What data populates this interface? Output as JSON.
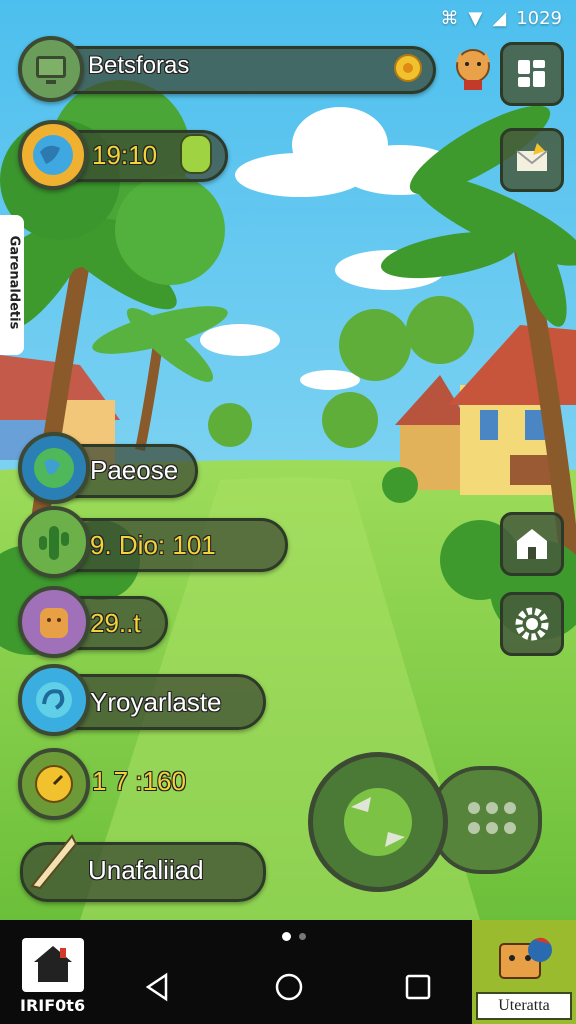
{
  "status_bar": {
    "time": "1029"
  },
  "top_bar": {
    "title": "Betsforas"
  },
  "timer": {
    "value": "19:10"
  },
  "side_text": "Garenaldetis",
  "menu": [
    {
      "label": "Paeose"
    },
    {
      "label": "9. Dio: 101"
    },
    {
      "label": "29..t"
    },
    {
      "label": "Yroyarlaste"
    },
    {
      "label": "1 7 :160"
    },
    {
      "label": "Unafaliiad"
    }
  ],
  "nav": {
    "left_label": "IRIF0t6",
    "right_label": "Uteratta"
  },
  "colors": {
    "sky": "#5cc6ef",
    "grass": "#8ad64a",
    "panel": "#3c4a34",
    "gold": "#f3d23a"
  }
}
